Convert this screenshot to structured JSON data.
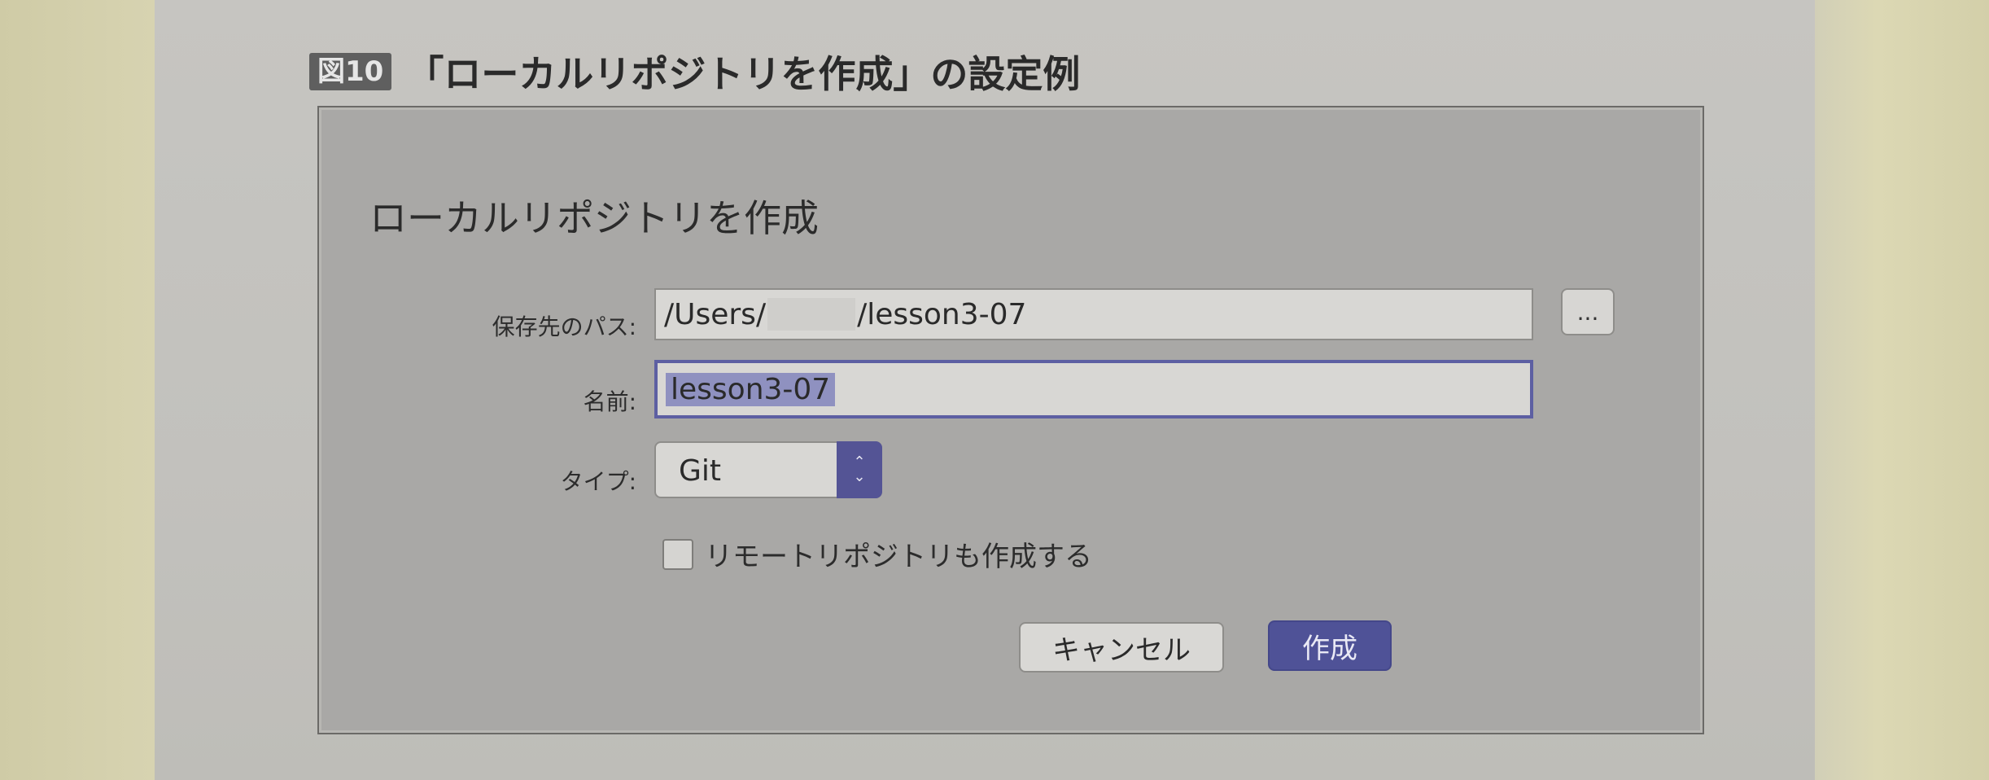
{
  "figure": {
    "badge": "図10",
    "caption": "「ローカルリポジトリを作成」の設定例"
  },
  "dialog": {
    "title": "ローカルリポジトリを作成",
    "path_label": "保存先のパス:",
    "path_value_prefix": "/Users/",
    "path_value_suffix": "/lesson3-07",
    "browse_label": "...",
    "name_label": "名前:",
    "name_value": "lesson3-07",
    "type_label": "タイプ:",
    "type_value": "Git",
    "remote_checkbox_label": "リモートリポジトリも作成する",
    "remote_checked": false,
    "cancel_label": "キャンセル",
    "create_label": "作成"
  },
  "colors": {
    "accent": "#4f5297",
    "selection": "#8f91c0"
  }
}
